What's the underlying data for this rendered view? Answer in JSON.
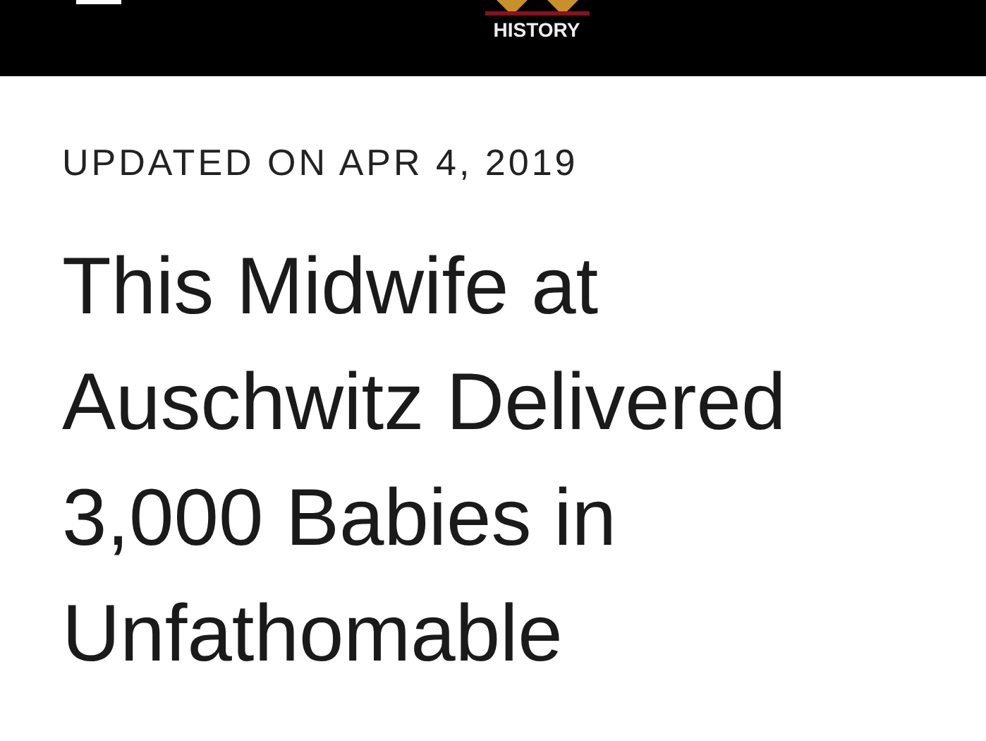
{
  "header": {
    "logo_text": "HISTORY"
  },
  "article": {
    "dateline": "UPDATED ON APR 4, 2019",
    "title_lines": [
      "This Midwife at",
      "Auschwitz Delivered",
      "3,000 Babies in",
      "Unfathomable"
    ]
  }
}
